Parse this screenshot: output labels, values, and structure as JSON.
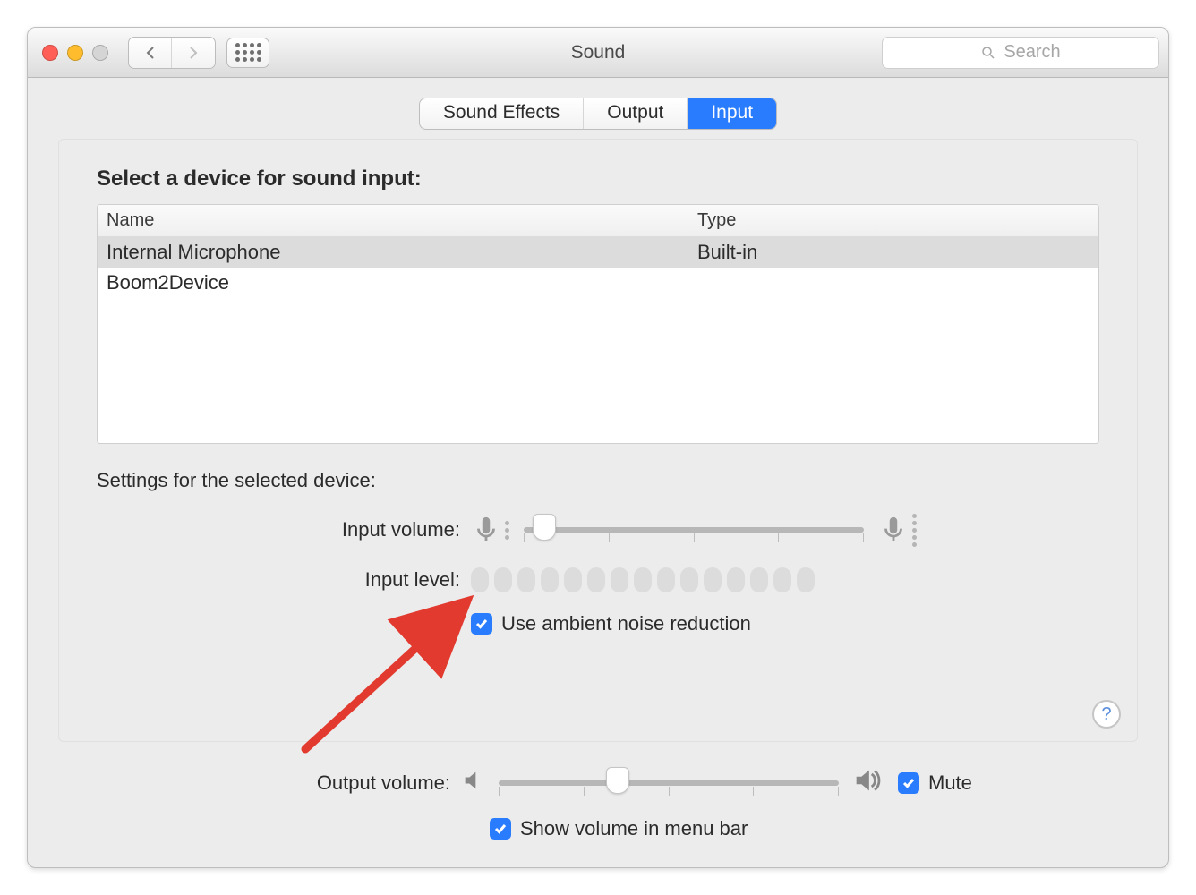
{
  "window": {
    "title": "Sound"
  },
  "toolbar": {
    "search_placeholder": "Search"
  },
  "tabs": {
    "items": [
      {
        "label": "Sound Effects"
      },
      {
        "label": "Output"
      },
      {
        "label": "Input"
      }
    ],
    "active_index": 2
  },
  "main": {
    "heading": "Select a device for sound input:",
    "columns": {
      "name": "Name",
      "type": "Type"
    },
    "devices": [
      {
        "name": "Internal Microphone",
        "type": "Built-in",
        "selected": true
      },
      {
        "name": "Boom2Device",
        "type": "",
        "selected": false
      }
    ],
    "settings_heading": "Settings for the selected device:",
    "input_volume_label": "Input volume:",
    "input_volume_percent": 6,
    "input_level_label": "Input level:",
    "input_level_value": 0,
    "noise_reduction_label": "Use ambient noise reduction",
    "noise_reduction_checked": true
  },
  "footer": {
    "output_volume_label": "Output volume:",
    "output_volume_percent": 35,
    "mute_label": "Mute",
    "mute_checked": true,
    "show_in_menubar_label": "Show volume in menu bar",
    "show_in_menubar_checked": true
  },
  "help_label": "?",
  "colors": {
    "accent": "#2a7cff"
  }
}
